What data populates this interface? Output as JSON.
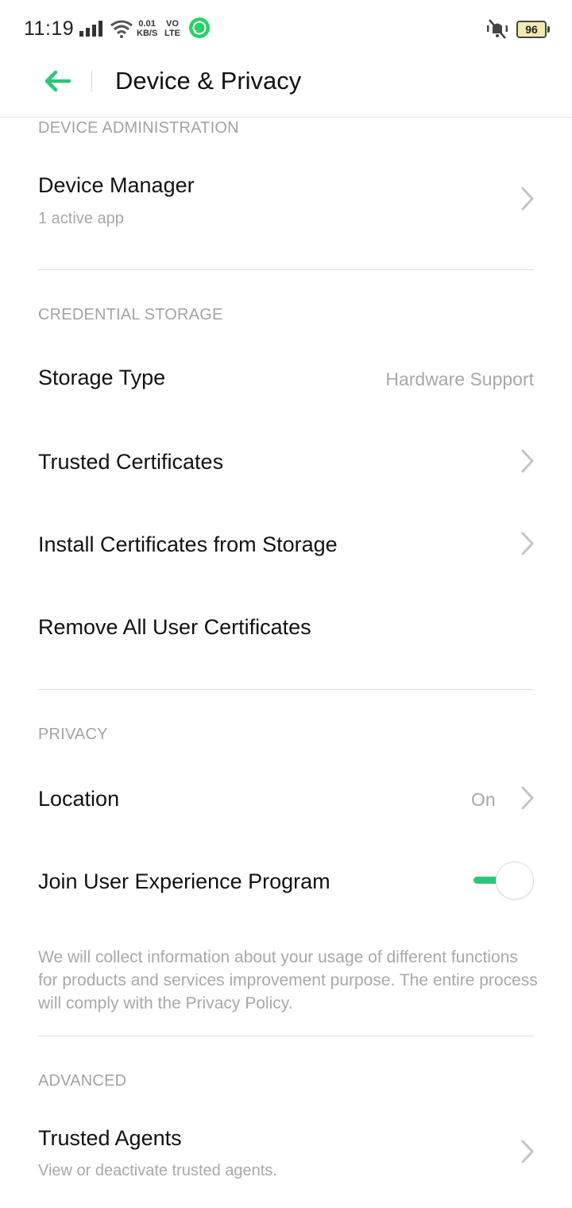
{
  "status_bar": {
    "time": "11:19",
    "net_speed_value": "0.01",
    "net_speed_unit": "KB/S",
    "volte_top": "VO",
    "volte_bottom": "LTE",
    "battery": "96"
  },
  "header": {
    "title": "Device & Privacy",
    "accent_color": "#2cc77a"
  },
  "sections": {
    "device_admin": {
      "header": "DEVICE ADMINISTRATION",
      "device_manager": {
        "title": "Device Manager",
        "subtitle": "1 active app"
      }
    },
    "credential_storage": {
      "header": "CREDENTIAL STORAGE",
      "storage_type": {
        "title": "Storage Type",
        "value": "Hardware Support"
      },
      "trusted_certificates": {
        "title": "Trusted Certificates"
      },
      "install_certificates": {
        "title": "Install Certificates from Storage"
      },
      "remove_certificates": {
        "title": "Remove All User Certificates"
      }
    },
    "privacy": {
      "header": "PRIVACY",
      "location": {
        "title": "Location",
        "value": "On"
      },
      "user_experience": {
        "title": "Join User Experience Program",
        "enabled": true
      },
      "note": "We will collect information about your usage of different functions for products and services improvement purpose. The entire process will comply with the Privacy Policy."
    },
    "advanced": {
      "header": "ADVANCED",
      "trusted_agents": {
        "title": "Trusted Agents",
        "subtitle": "View or deactivate trusted agents."
      }
    }
  }
}
